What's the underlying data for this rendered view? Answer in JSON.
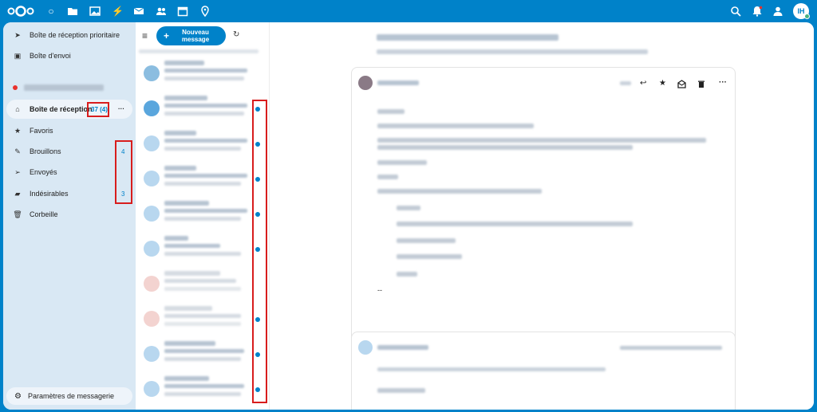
{
  "user_initials": "IH",
  "colors": {
    "brand": "#0082c9",
    "highlight_box": "#d81d1d",
    "unread_dot": "#0082c9"
  },
  "top_icons": [
    "files-icon",
    "photos-icon",
    "activity-icon",
    "mail-icon",
    "contacts-icon",
    "calendar-icon",
    "maps-icon"
  ],
  "nav": {
    "items": [
      {
        "label": "Boîte de réception prioritaire",
        "icon": "priority-inbox-icon"
      },
      {
        "label": "Boîte d'envoi",
        "icon": "outbox-icon"
      },
      {
        "label": "Boîte de réception",
        "icon": "home-icon",
        "count": "37 (4)"
      },
      {
        "label": "Favoris",
        "icon": "star-icon"
      },
      {
        "label": "Brouillons",
        "icon": "pencil-icon",
        "count": "4"
      },
      {
        "label": "Envoyés",
        "icon": "send-icon"
      },
      {
        "label": "Indésirables",
        "icon": "folder-icon",
        "count": "3"
      },
      {
        "label": "Corbeille",
        "icon": "trash-icon"
      }
    ],
    "settings_label": "Paramètres de messagerie",
    "more_label": "···"
  },
  "toolbar": {
    "new_message_label": "Nouveau message"
  },
  "message": {
    "signature_dashes": "--"
  }
}
